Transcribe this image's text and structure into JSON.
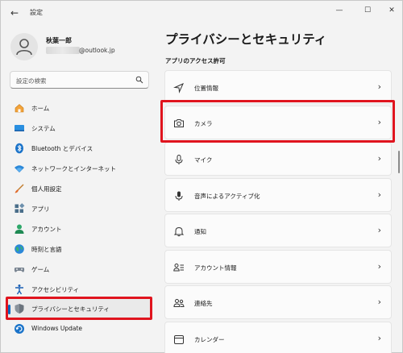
{
  "window": {
    "title": "設定",
    "back": "←",
    "minimize": "—",
    "maximize": "☐",
    "close": "✕"
  },
  "user": {
    "name": "秋葉一郎",
    "email_visible": "@outlook.jp"
  },
  "search": {
    "placeholder": "設定の検索"
  },
  "sidebar": {
    "items": [
      {
        "label": "ホーム",
        "icon": "home-icon",
        "active": false
      },
      {
        "label": "システム",
        "icon": "system-icon",
        "active": false
      },
      {
        "label": "Bluetooth とデバイス",
        "icon": "bluetooth-icon",
        "active": false
      },
      {
        "label": "ネットワークとインターネット",
        "icon": "wifi-icon",
        "active": false
      },
      {
        "label": "個人用設定",
        "icon": "brush-icon",
        "active": false
      },
      {
        "label": "アプリ",
        "icon": "apps-icon",
        "active": false
      },
      {
        "label": "アカウント",
        "icon": "account-icon",
        "active": false
      },
      {
        "label": "時刻と言語",
        "icon": "globe-icon",
        "active": false
      },
      {
        "label": "ゲーム",
        "icon": "gamepad-icon",
        "active": false
      },
      {
        "label": "アクセシビリティ",
        "icon": "accessibility-icon",
        "active": false
      },
      {
        "label": "プライバシーとセキュリティ",
        "icon": "shield-icon",
        "active": true
      },
      {
        "label": "Windows Update",
        "icon": "update-icon",
        "active": false
      }
    ]
  },
  "main": {
    "title": "プライバシーとセキュリティ",
    "section": "アプリのアクセス許可",
    "cards": [
      {
        "label": "位置情報",
        "icon": "location-icon"
      },
      {
        "label": "カメラ",
        "icon": "camera-icon"
      },
      {
        "label": "マイク",
        "icon": "microphone-icon"
      },
      {
        "label": "音声によるアクティブ化",
        "icon": "voice-activation-icon"
      },
      {
        "label": "通知",
        "icon": "bell-icon"
      },
      {
        "label": "アカウント情報",
        "icon": "account-info-icon"
      },
      {
        "label": "連絡先",
        "icon": "contacts-icon"
      },
      {
        "label": "カレンダー",
        "icon": "calendar-icon"
      }
    ],
    "chevron": "›"
  },
  "colors": {
    "accent": "#0067c0",
    "highlight": "#e0141e",
    "background": "#f3f3f3",
    "card": "#fbfbfb"
  }
}
